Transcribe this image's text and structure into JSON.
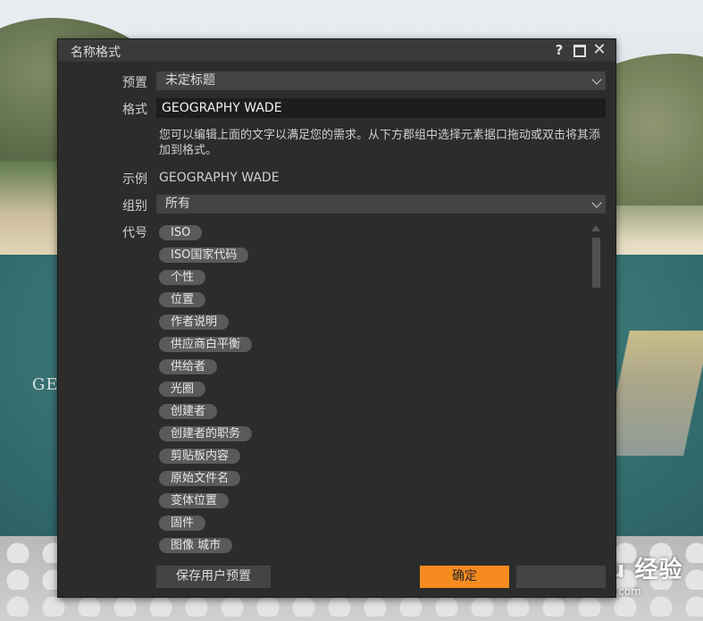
{
  "background": {
    "watermark_text": "GE",
    "logo_text": "Bai du 经验",
    "logo_url": "jingyan.baidu.com"
  },
  "dialog": {
    "title": "名称格式",
    "controls": {
      "help": "?",
      "close": "✕"
    },
    "preset": {
      "label": "预置",
      "value": "未定标题"
    },
    "format": {
      "label": "格式",
      "value": "GEOGRAPHY WADE"
    },
    "help_text": "您可以编辑上面的文字以满足您的需求。从下方郡组中选择元素据口拖动或双击将其添加到格式。",
    "example": {
      "label": "示例",
      "value": "GEOGRAPHY WADE"
    },
    "group": {
      "label": "组别",
      "value": "所有"
    },
    "tokens": {
      "label": "代号",
      "items": [
        "ISO",
        "ISO国家代码",
        "个性",
        "位置",
        "作者说明",
        "供应商白平衡",
        "供给者",
        "光圈",
        "创建者",
        "创建者的职务",
        "剪贴板内容",
        "原始文件名",
        "变体位置",
        "固件",
        "图像 城市"
      ]
    },
    "buttons": {
      "save_preset": "保存用户预置",
      "ok": "确定",
      "cancel": ""
    }
  },
  "colors": {
    "accent": "#f68b1f",
    "panel": "#2c2c2c",
    "token": "#5a5a5a"
  }
}
